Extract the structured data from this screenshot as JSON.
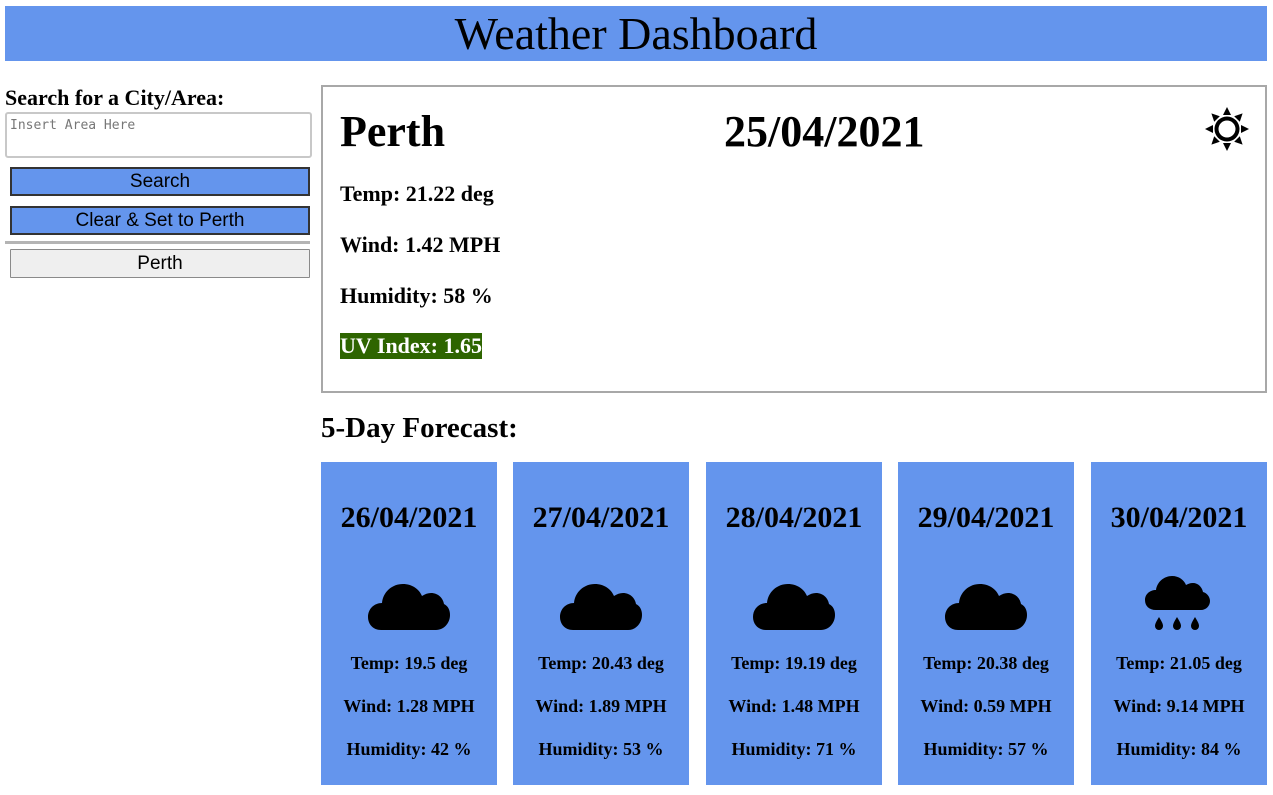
{
  "header": {
    "title": "Weather Dashboard"
  },
  "sidebar": {
    "search_label": "Search for a City/Area:",
    "search_placeholder": "Insert Area Here",
    "search_value": "",
    "search_button": "Search",
    "clear_button": "Clear & Set to Perth",
    "history": [
      "Perth"
    ]
  },
  "current": {
    "city": "Perth",
    "date": "25/04/2021",
    "icon": "sun-icon",
    "temp": "Temp: 21.22 deg",
    "wind": "Wind: 1.42 MPH",
    "humidity": "Humidity: 58 %",
    "uv": "UV Index: 1.65",
    "uv_color": "#2e6500"
  },
  "forecast": {
    "title": "5-Day Forecast:",
    "days": [
      {
        "date": "26/04/2021",
        "icon": "cloud-icon",
        "temp": "Temp: 19.5 deg",
        "wind": "Wind: 1.28 MPH",
        "humidity": "Humidity: 42 %"
      },
      {
        "date": "27/04/2021",
        "icon": "cloud-icon",
        "temp": "Temp: 20.43 deg",
        "wind": "Wind: 1.89 MPH",
        "humidity": "Humidity: 53 %"
      },
      {
        "date": "28/04/2021",
        "icon": "cloud-icon",
        "temp": "Temp: 19.19 deg",
        "wind": "Wind: 1.48 MPH",
        "humidity": "Humidity: 71 %"
      },
      {
        "date": "29/04/2021",
        "icon": "cloud-icon",
        "temp": "Temp: 20.38 deg",
        "wind": "Wind: 0.59 MPH",
        "humidity": "Humidity: 57 %"
      },
      {
        "date": "30/04/2021",
        "icon": "rain-cloud-icon",
        "temp": "Temp: 21.05 deg",
        "wind": "Wind: 9.14 MPH",
        "humidity": "Humidity: 84 %"
      }
    ]
  },
  "colors": {
    "accent": "#6495ed",
    "card": "#6495ed",
    "uv_low": "#2e6500"
  }
}
